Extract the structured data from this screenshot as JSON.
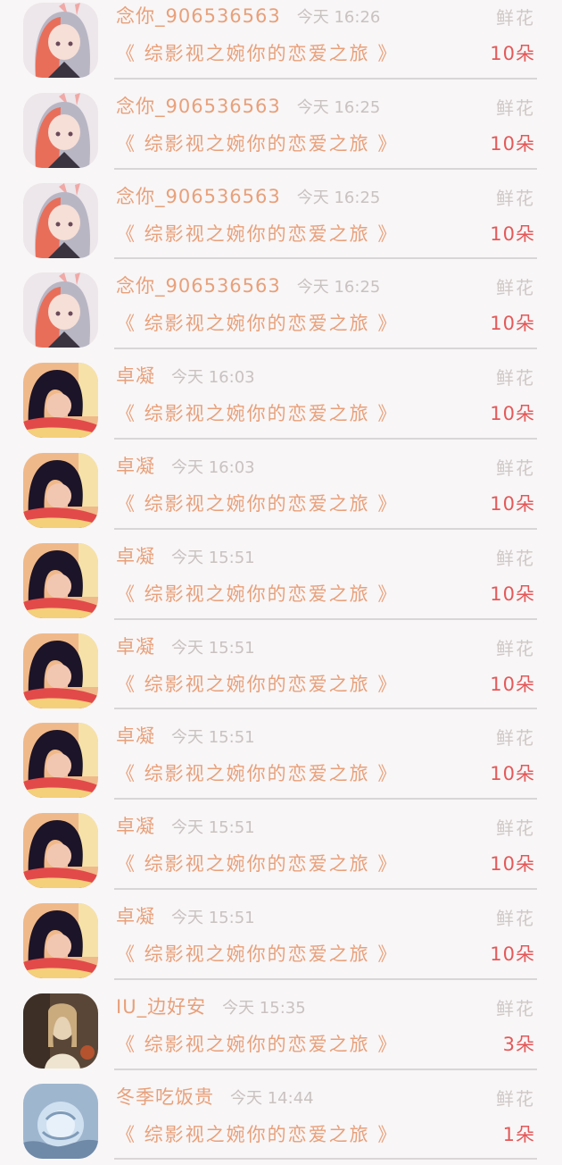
{
  "book_title": "《 综影视之婉你的恋爱之旅 》",
  "gift_type": "鲜花",
  "rows": [
    {
      "user": "念你_906536563",
      "time": "今天 16:26",
      "count": "10朵",
      "avatar": "anime-girl"
    },
    {
      "user": "念你_906536563",
      "time": "今天 16:25",
      "count": "10朵",
      "avatar": "anime-girl"
    },
    {
      "user": "念你_906536563",
      "time": "今天 16:25",
      "count": "10朵",
      "avatar": "anime-girl"
    },
    {
      "user": "念你_906536563",
      "time": "今天 16:25",
      "count": "10朵",
      "avatar": "anime-girl"
    },
    {
      "user": "卓凝",
      "time": "今天 16:03",
      "count": "10朵",
      "avatar": "dark-hair-girl"
    },
    {
      "user": "卓凝",
      "time": "今天 16:03",
      "count": "10朵",
      "avatar": "dark-hair-girl"
    },
    {
      "user": "卓凝",
      "time": "今天 15:51",
      "count": "10朵",
      "avatar": "dark-hair-girl"
    },
    {
      "user": "卓凝",
      "time": "今天 15:51",
      "count": "10朵",
      "avatar": "dark-hair-girl"
    },
    {
      "user": "卓凝",
      "time": "今天 15:51",
      "count": "10朵",
      "avatar": "dark-hair-girl"
    },
    {
      "user": "卓凝",
      "time": "今天 15:51",
      "count": "10朵",
      "avatar": "dark-hair-girl"
    },
    {
      "user": "卓凝",
      "time": "今天 15:51",
      "count": "10朵",
      "avatar": "dark-hair-girl"
    },
    {
      "user": "IU_边好安",
      "time": "今天 15:35",
      "count": "3朵",
      "avatar": "sepia-girl"
    },
    {
      "user": "冬季吃饭贵",
      "time": "今天 14:44",
      "count": "1朵",
      "avatar": "blue-flower"
    }
  ],
  "colors": {
    "background": "#f8f6f7",
    "accent": "#e8a07a",
    "count": "#e45858",
    "muted": "#c9c2c0",
    "divider": "#d9d6d7"
  }
}
